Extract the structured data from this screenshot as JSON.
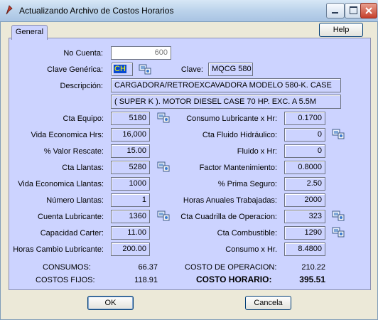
{
  "window": {
    "title": "Actualizando Archivo de Costos Horarios"
  },
  "tabs": [
    {
      "label": "General"
    }
  ],
  "help_label": "Help",
  "fields": {
    "no_cuenta": {
      "label": "No Cuenta:",
      "value": "600"
    },
    "clave_generica": {
      "label": "Clave Genérica:",
      "value": "CH"
    },
    "clave": {
      "label": "Clave:",
      "value": "MQCG 580"
    },
    "descripcion": {
      "label": "Descripción:",
      "line1": "CARGADORA/RETROEXCAVADORA MODELO 580-K. CASE",
      "line2": "( SUPER K ). MOTOR DIESEL CASE 70 HP. EXC. A 5.5M"
    }
  },
  "left": [
    {
      "label": "Cta Equipo:",
      "value": "5180"
    },
    {
      "label": "Vida Economica Hrs:",
      "value": "16,000"
    },
    {
      "label": "% Valor Rescate:",
      "value": "15.00"
    },
    {
      "label": "Cta Llantas:",
      "value": "5280"
    },
    {
      "label": "Vida Economica Llantas:",
      "value": "1000"
    },
    {
      "label": "Número Llantas:",
      "value": "1"
    },
    {
      "label": "Cuenta Lubricante:",
      "value": "1360"
    },
    {
      "label": "Capacidad Carter:",
      "value": "11.00"
    },
    {
      "label": "Horas Cambio Lubricante:",
      "value": "200.00"
    }
  ],
  "right": [
    {
      "label": "Consumo Lubricante x Hr:",
      "value": "0.1700"
    },
    {
      "label": "Cta Fluido Hidráulico:",
      "value": "0"
    },
    {
      "label": "Fluido x Hr:",
      "value": "0"
    },
    {
      "label": "Factor Mantenimiento:",
      "value": "0.8000"
    },
    {
      "label": "% Prima Seguro:",
      "value": "2.50"
    },
    {
      "label": "Horas Anuales Trabajadas:",
      "value": "2000"
    },
    {
      "label": "Cta Cuadrilla de Operacion:",
      "value": "323"
    },
    {
      "label": "Cta Combustible:",
      "value": "1290"
    },
    {
      "label": "Consumo x Hr.",
      "value": "8.4800"
    }
  ],
  "summary": {
    "consumos_label": "CONSUMOS:",
    "consumos_value": "66.37",
    "costos_fijos_label": "COSTOS FIJOS:",
    "costos_fijos_value": "118.91",
    "costo_operacion_label": "COSTO DE OPERACION:",
    "costo_operacion_value": "210.22",
    "costo_horario_label": "COSTO HORARIO:",
    "costo_horario_value": "395.51"
  },
  "buttons": {
    "ok": "OK",
    "cancel": "Cancela"
  }
}
